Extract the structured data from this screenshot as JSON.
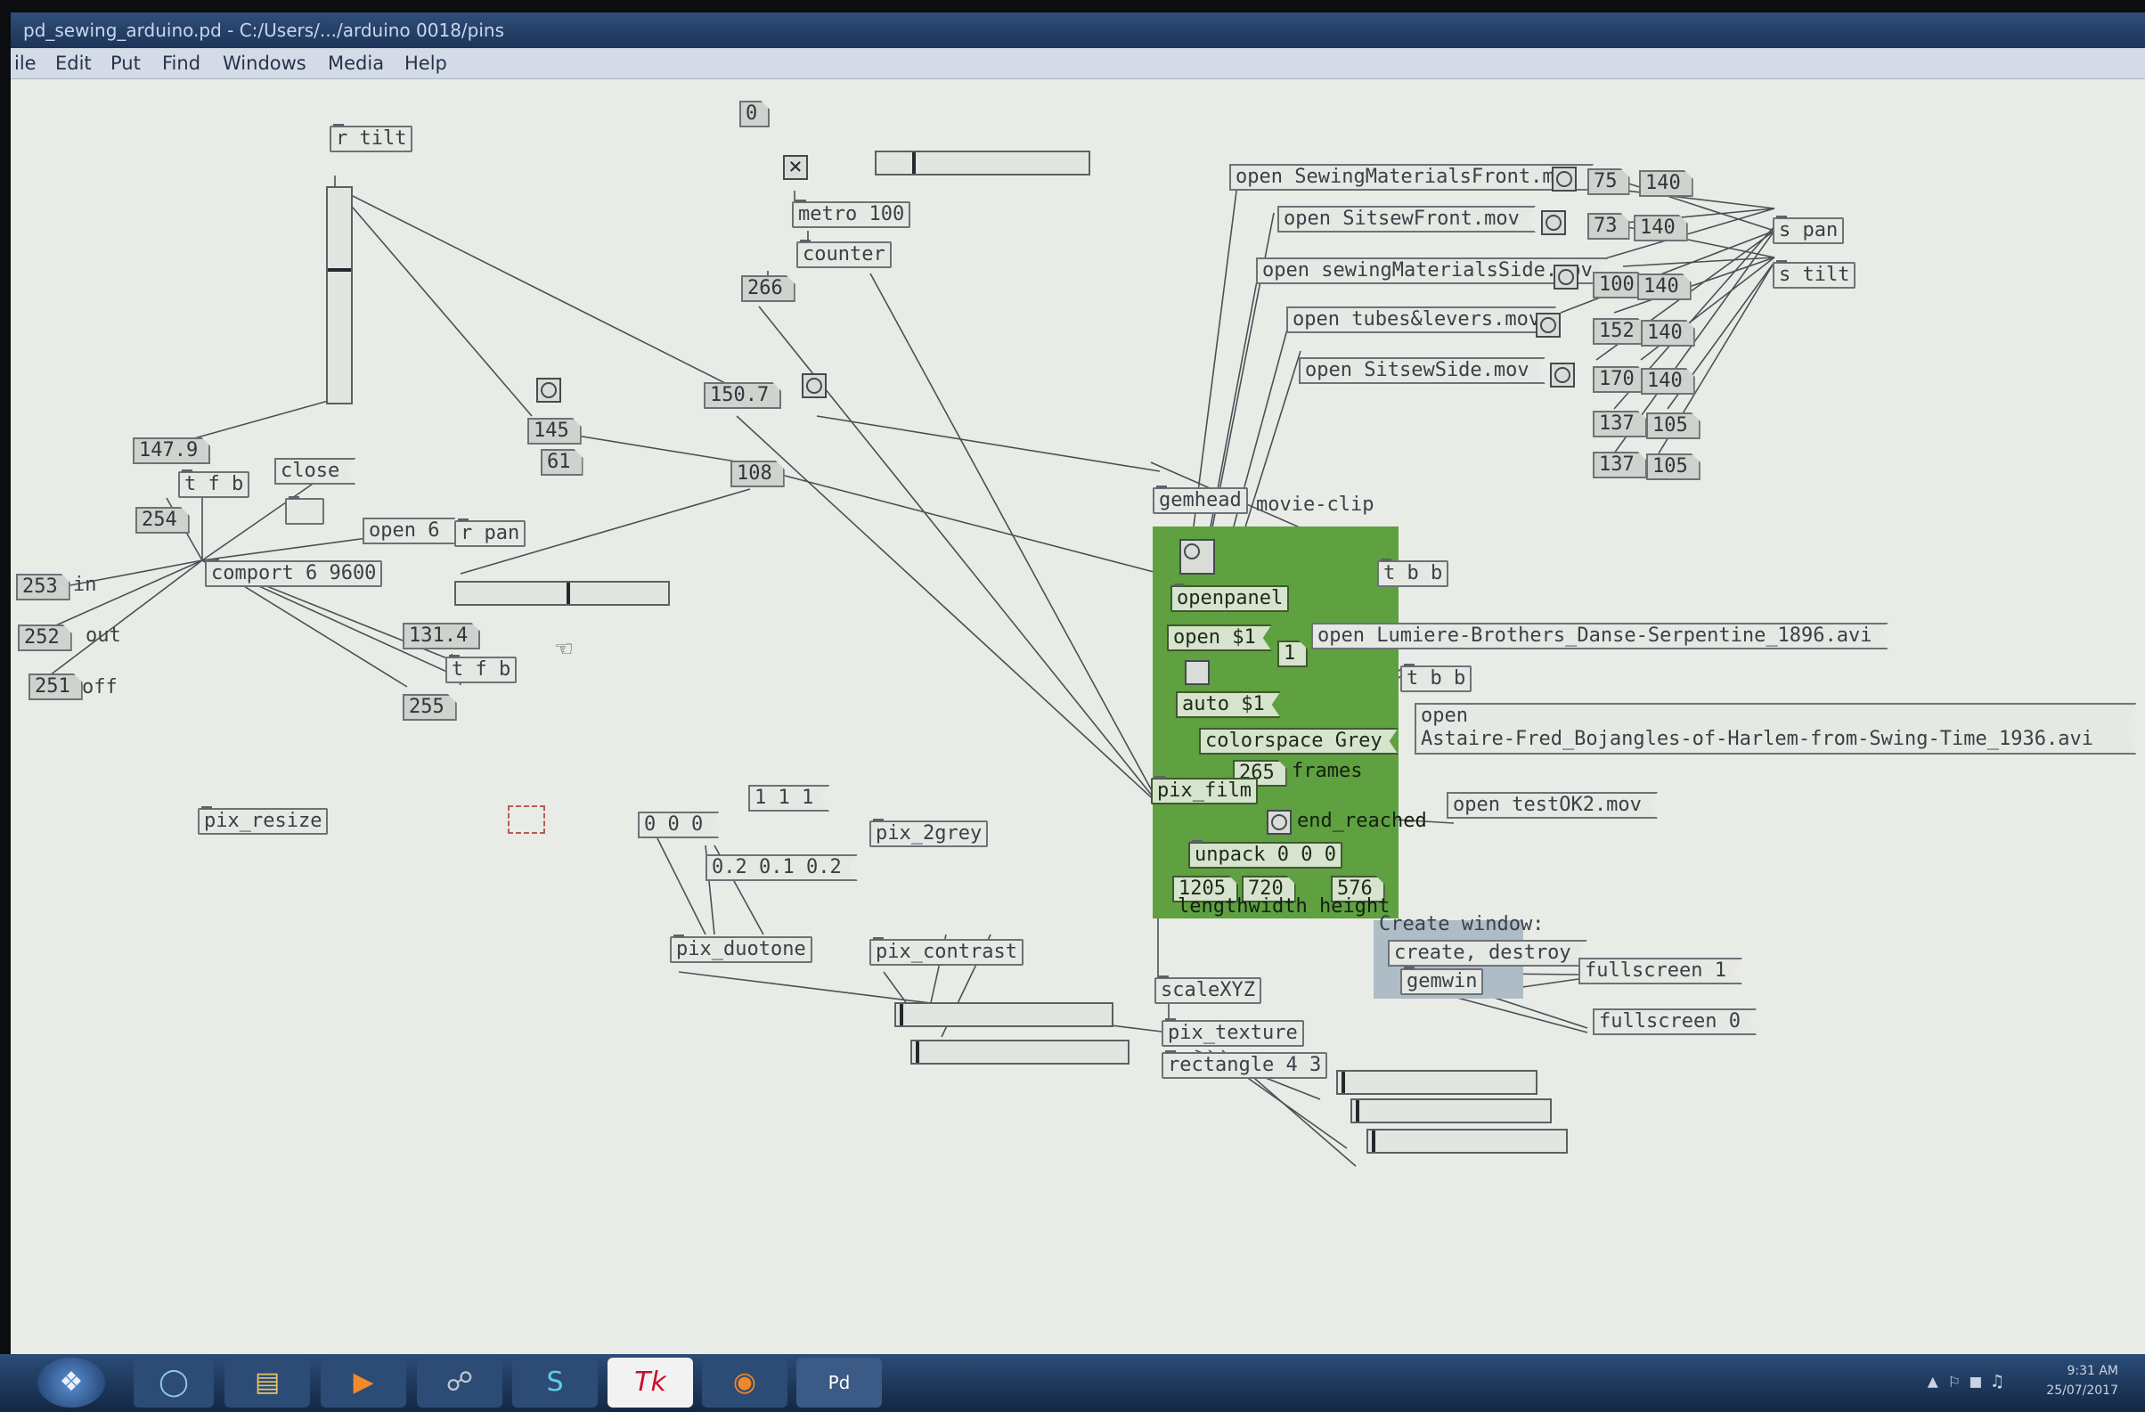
{
  "window": {
    "title": "pd_sewing_arduino.pd - C:/Users/.../arduino 0018/pins"
  },
  "menu": [
    "ile",
    "Edit",
    "Put",
    "Find",
    "Windows",
    "Media",
    "Help"
  ],
  "objects": {
    "r_tilt": "r tilt",
    "t_f_b_1": "t f b",
    "close": "close",
    "open6": "open 6",
    "r_pan": "r pan",
    "comport": "comport 6 9600",
    "t_f_b_2": "t f b",
    "pix_resize": "pix_resize",
    "metro": "metro 100",
    "counter": "counter",
    "pix_2grey": "pix_2grey",
    "pix_duotone": "pix_duotone",
    "pix_contrast": "pix_contrast",
    "msg_000": "0 0 0",
    "msg_111": "1 1 1",
    "msg_frac": "0.2 0.1 0.2",
    "open_sm_front": "open SewingMaterialsFront.mov",
    "open_sitsew_front": "open SitsewFront.mov",
    "open_sm_side": "open sewingMaterialsSide.mov",
    "open_tubes": "open tubes&levers.mov",
    "open_sitsew_side": "open SitsewSide.mov",
    "s_pan": "s pan",
    "s_tilt": "s tilt",
    "gemhead": "gemhead",
    "movie_clip": "movie-clip",
    "openpanel": "openpanel",
    "open_s1": "open $1",
    "auto_s1": "auto $1",
    "colorspace": "colorspace Grey",
    "frames": "frames",
    "pix_film": "pix_film",
    "end_reached": "end_reached",
    "unpack": "unpack 0 0 0",
    "dims_label": "lengthwidth height",
    "t_b_b_1": "t b b",
    "t_b_b_2": "t b b",
    "open_lumiere": "open Lumiere-Brothers_Danse-Serpentine_1896.avi",
    "open_astaire_1": "open",
    "open_astaire_2": "Astaire-Fred_Bojangles-of-Harlem-from-Swing-Time_1936.avi",
    "open_test": "open testOK2.mov",
    "create_window": "Create window:",
    "create_destroy": "create, destroy",
    "gemwin": "gemwin",
    "fullscreen1": "fullscreen 1",
    "fullscreen0": "fullscreen 0",
    "scalexyz": "scaleXYZ",
    "pix_texture": "pix_texture",
    "rectangle": "rectangle 4 3"
  },
  "numbers": {
    "top_zero": "0",
    "n266": "266",
    "n150_7": "150.7",
    "n145": "145",
    "n61": "61",
    "n108": "108",
    "n147_9": "147.9",
    "n254": "254",
    "n253": "253",
    "n252": "252",
    "n251": "251",
    "n131_4": "131.4",
    "n255": "255",
    "n1": "1",
    "n265": "265",
    "n1205": "1205",
    "n720": "720",
    "n576": "576",
    "p75": "75",
    "p140a": "140",
    "p73": "73",
    "p140b": "140",
    "p100": "100",
    "p140c": "140",
    "p152": "152",
    "p140d": "140",
    "p170": "170",
    "p140e": "140",
    "p137a": "137",
    "p105a": "105",
    "p137b": "137",
    "p105b": "105"
  },
  "comments": {
    "in": "in",
    "out": "out",
    "off": "off"
  },
  "sliders": {
    "h_top": 0.18,
    "v_tilt": 0.38,
    "h_pan": 0.53
  },
  "taskbar": {
    "pd_label": "Pd",
    "clock_time": "9:31 AM",
    "clock_date": "25/07/2017"
  },
  "colors": {
    "gop_green": "#5fa040",
    "gemwin_blue": "#aebcc6",
    "title_blue": "#1c3458"
  }
}
